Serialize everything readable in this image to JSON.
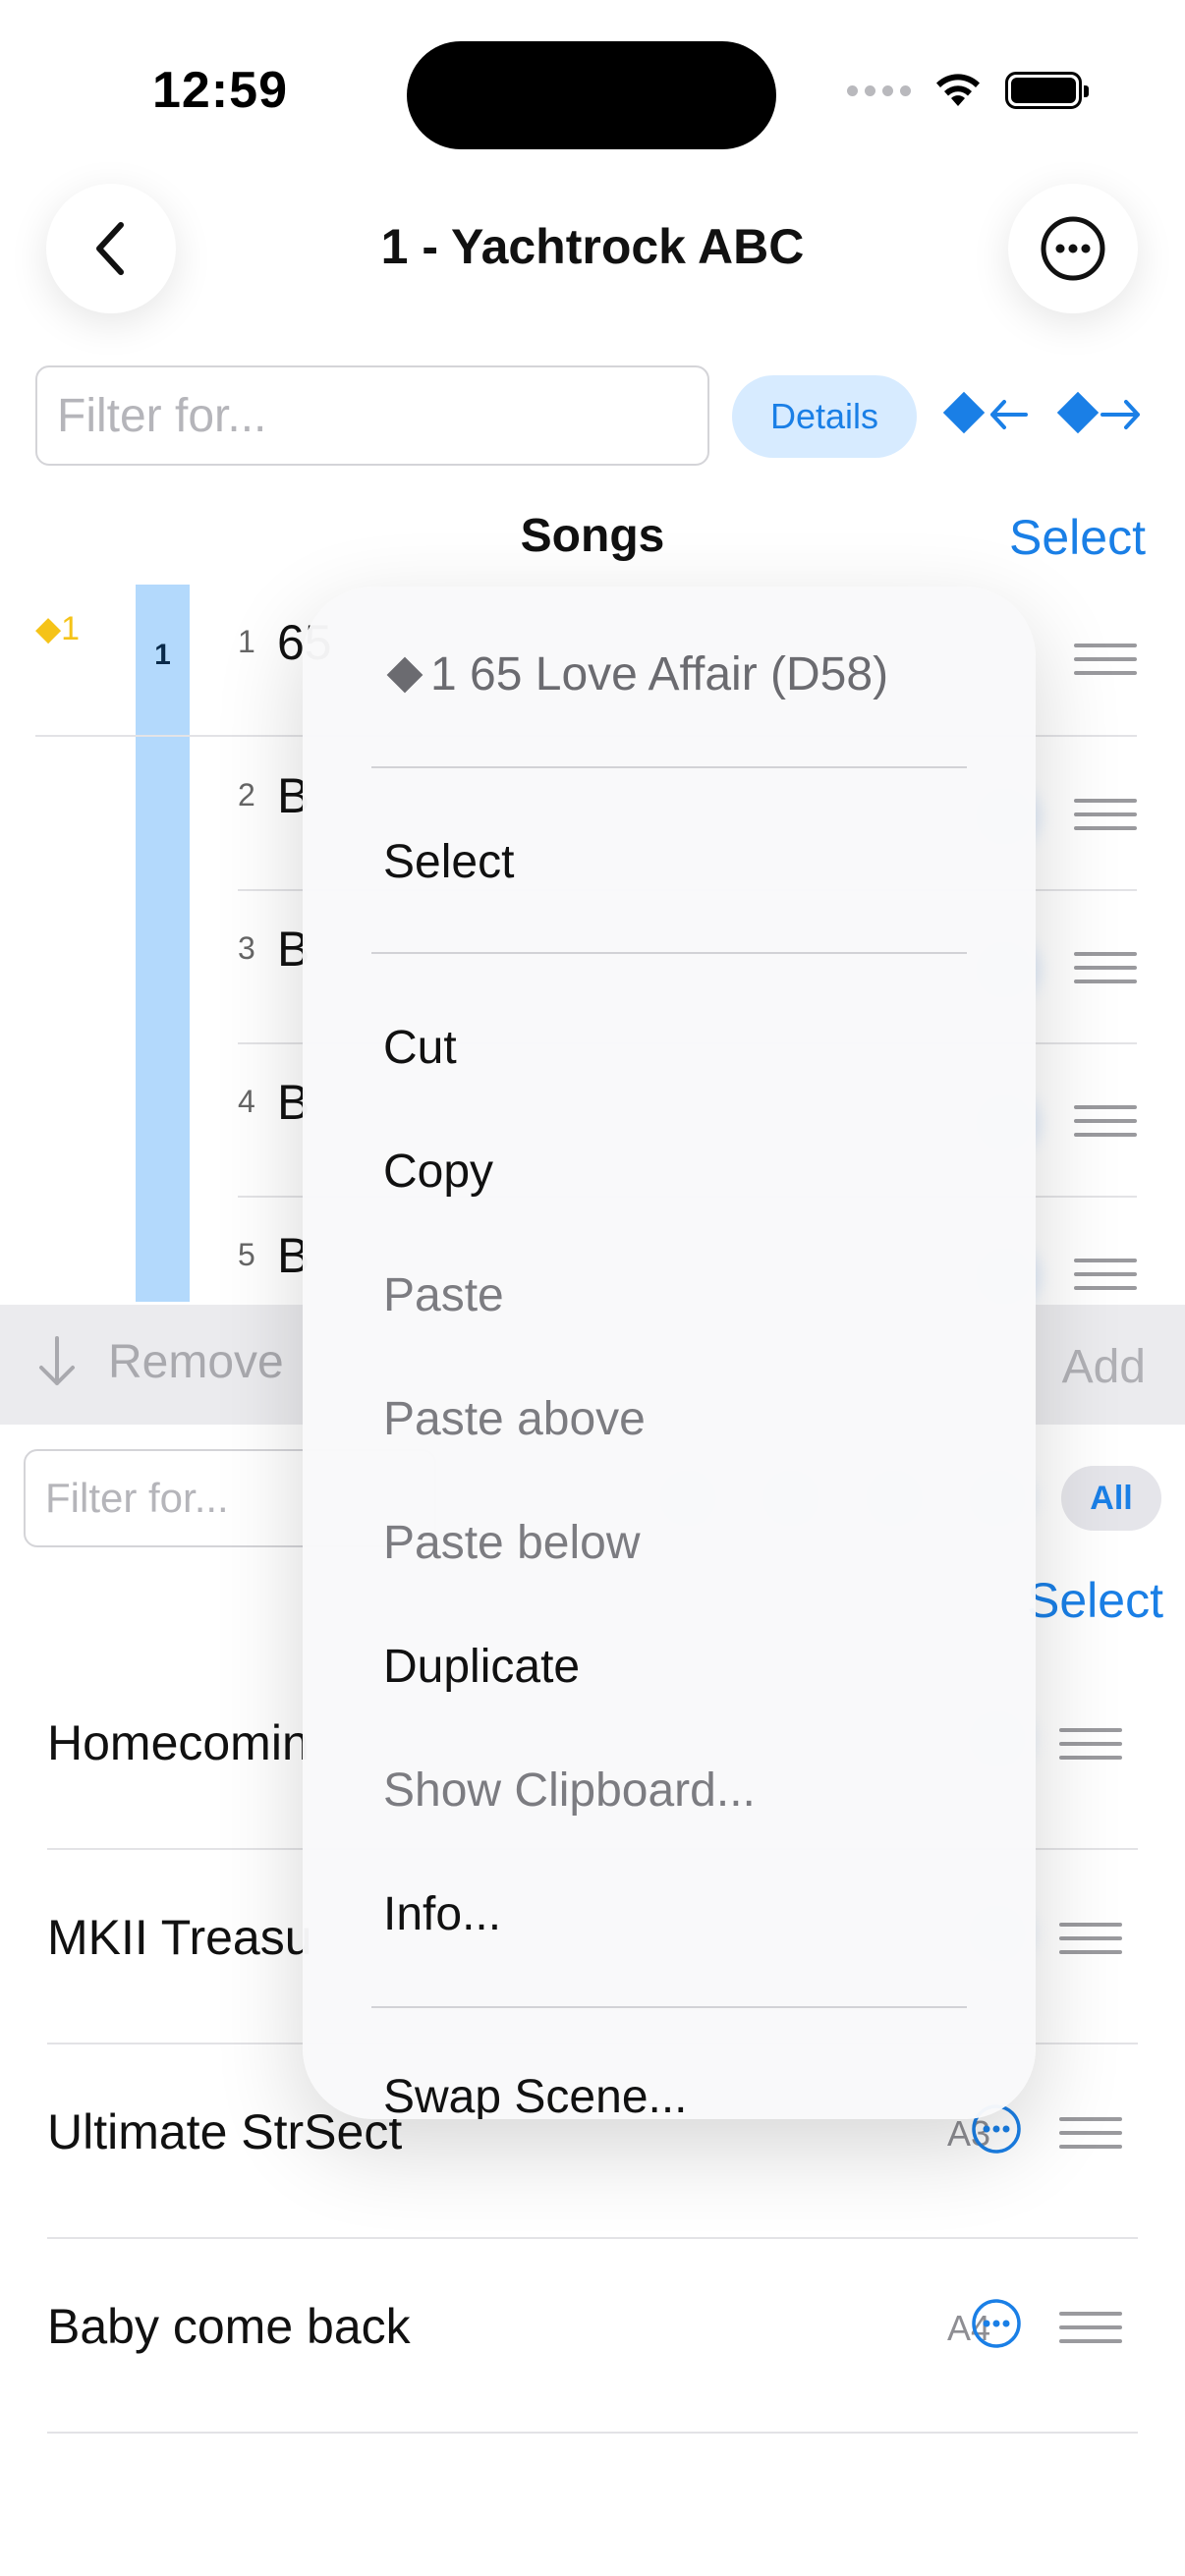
{
  "status_bar": {
    "time": "12:59"
  },
  "nav": {
    "title": "1 - Yachtrock ABC"
  },
  "filter_top": {
    "placeholder": "Filter for..."
  },
  "details_button": "Details",
  "songs_section": {
    "title": "Songs",
    "select_label": "Select"
  },
  "scene": {
    "marker_label": "1",
    "bar_label": "1"
  },
  "songs": [
    {
      "number": "1",
      "visible_text": "65"
    },
    {
      "number": "2",
      "visible_text": "B"
    },
    {
      "number": "3",
      "visible_text": "B"
    },
    {
      "number": "4",
      "visible_text": "B"
    },
    {
      "number": "5",
      "visible_text": "B"
    }
  ],
  "toolbar": {
    "remove_label": "Remove",
    "add_label": "Add"
  },
  "filter_bottom": {
    "placeholder": "Filter for...",
    "all_label": "All",
    "select_label": "Select"
  },
  "library": [
    {
      "name": "Homecomin",
      "key": ""
    },
    {
      "name": "MKII Treasu",
      "key": ""
    },
    {
      "name": "Ultimate StrSect",
      "key": "A3"
    },
    {
      "name": "Baby come back",
      "key": "A4"
    }
  ],
  "context_menu": {
    "header": "1 65 Love Affair (D58)",
    "items": [
      {
        "label": "Select",
        "enabled": true
      },
      {
        "label": "Cut",
        "enabled": true
      },
      {
        "label": "Copy",
        "enabled": true
      },
      {
        "label": "Paste",
        "enabled": false
      },
      {
        "label": "Paste above",
        "enabled": false
      },
      {
        "label": "Paste below",
        "enabled": false
      },
      {
        "label": "Duplicate",
        "enabled": true
      },
      {
        "label": "Show Clipboard...",
        "enabled": false
      },
      {
        "label": "Info...",
        "enabled": true
      },
      {
        "label": "Swap Scene...",
        "enabled": true
      }
    ]
  },
  "colors": {
    "accent": "#1a7fe6",
    "scene_bar": "#b3d9fc",
    "marker": "#f5c318"
  }
}
